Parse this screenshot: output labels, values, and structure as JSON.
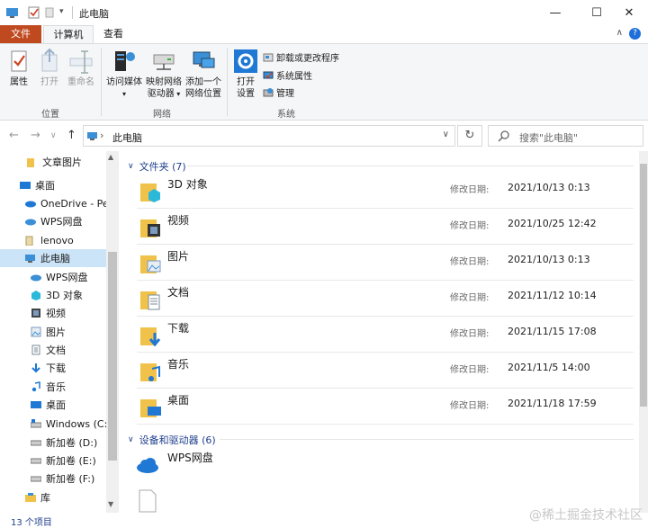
{
  "window": {
    "title": "此电脑",
    "minimize": "—",
    "maximize": "☐",
    "close": "✕"
  },
  "ribbon": {
    "tabs": [
      {
        "label": "文件"
      },
      {
        "label": "计算机"
      },
      {
        "label": "查看"
      }
    ],
    "location_group": {
      "label": "位置",
      "buttons": [
        {
          "label": "属性"
        },
        {
          "label": "打开"
        },
        {
          "label": "重命名"
        }
      ]
    },
    "network_group": {
      "label": "网络",
      "buttons": [
        {
          "label_line1": "访问媒体",
          "label_line2": ""
        },
        {
          "label_line1": "映射网络",
          "label_line2": "驱动器"
        },
        {
          "label_line1": "添加一个",
          "label_line2": "网络位置"
        }
      ]
    },
    "system_group": {
      "label": "系统",
      "open_settings_line1": "打开",
      "open_settings_line2": "设置",
      "small_buttons": [
        {
          "label": "卸载或更改程序"
        },
        {
          "label": "系统属性"
        },
        {
          "label": "管理"
        }
      ]
    }
  },
  "address": {
    "path": "此电脑",
    "search_placeholder": "搜索\"此电脑\""
  },
  "nav": {
    "items": [
      {
        "label": "文章图片"
      },
      {
        "label": "桌面"
      },
      {
        "label": "OneDrive - Pers"
      },
      {
        "label": "WPS网盘"
      },
      {
        "label": "lenovo"
      },
      {
        "label": "此电脑"
      },
      {
        "label": "WPS网盘"
      },
      {
        "label": "3D 对象"
      },
      {
        "label": "视频"
      },
      {
        "label": "图片"
      },
      {
        "label": "文档"
      },
      {
        "label": "下载"
      },
      {
        "label": "音乐"
      },
      {
        "label": "桌面"
      },
      {
        "label": "Windows (C:)"
      },
      {
        "label": "新加卷 (D:)"
      },
      {
        "label": "新加卷 (E:)"
      },
      {
        "label": "新加卷 (F:)"
      },
      {
        "label": "库"
      }
    ]
  },
  "content": {
    "folders_header": "文件夹 (7)",
    "date_label": "修改日期:",
    "folders": [
      {
        "name": "3D 对象",
        "date": "2021/10/13 0:13"
      },
      {
        "name": "视频",
        "date": "2021/10/25 12:42"
      },
      {
        "name": "图片",
        "date": "2021/10/13 0:13"
      },
      {
        "name": "文档",
        "date": "2021/11/12 10:14"
      },
      {
        "name": "下载",
        "date": "2021/11/15 17:08"
      },
      {
        "name": "音乐",
        "date": "2021/11/5 14:00"
      },
      {
        "name": "桌面",
        "date": "2021/11/18 17:59"
      }
    ],
    "devices_header": "设备和驱动器 (6)",
    "devices": [
      {
        "name": "WPS网盘"
      }
    ]
  },
  "status": {
    "item_count": "13 个项目"
  },
  "watermark": "@稀土掘金技术社区",
  "colors": {
    "file_tab": "#c04a20",
    "selected": "#cce4f7",
    "header_blue": "#1e3e8c",
    "folder_yellow": "#f0c24a"
  }
}
